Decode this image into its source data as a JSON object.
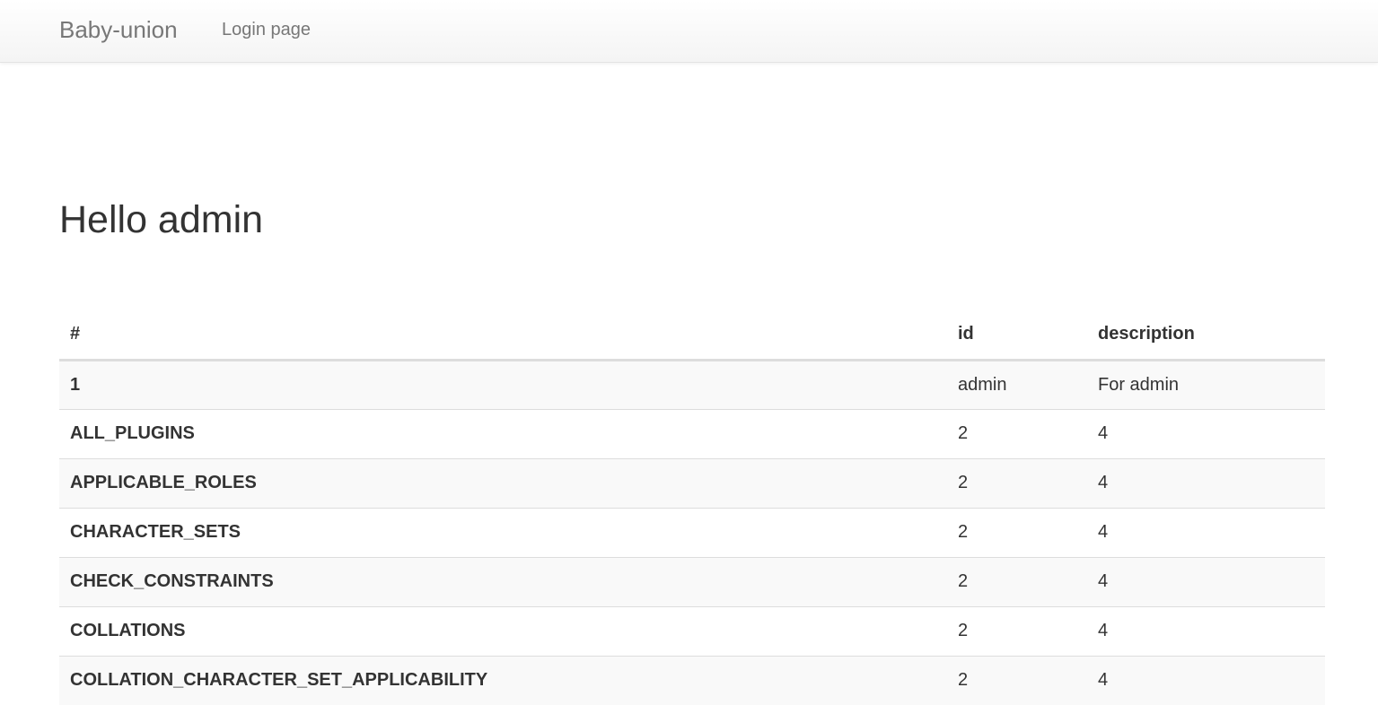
{
  "navbar": {
    "brand": "Baby-union",
    "links": [
      {
        "label": "Login page"
      }
    ]
  },
  "main": {
    "greeting": "Hello admin"
  },
  "table": {
    "headers": [
      "#",
      "id",
      "description"
    ],
    "rows": [
      [
        "1",
        "admin",
        "For admin"
      ],
      [
        "ALL_PLUGINS",
        "2",
        "4"
      ],
      [
        "APPLICABLE_ROLES",
        "2",
        "4"
      ],
      [
        "CHARACTER_SETS",
        "2",
        "4"
      ],
      [
        "CHECK_CONSTRAINTS",
        "2",
        "4"
      ],
      [
        "COLLATIONS",
        "2",
        "4"
      ],
      [
        "COLLATION_CHARACTER_SET_APPLICABILITY",
        "2",
        "4"
      ]
    ]
  }
}
